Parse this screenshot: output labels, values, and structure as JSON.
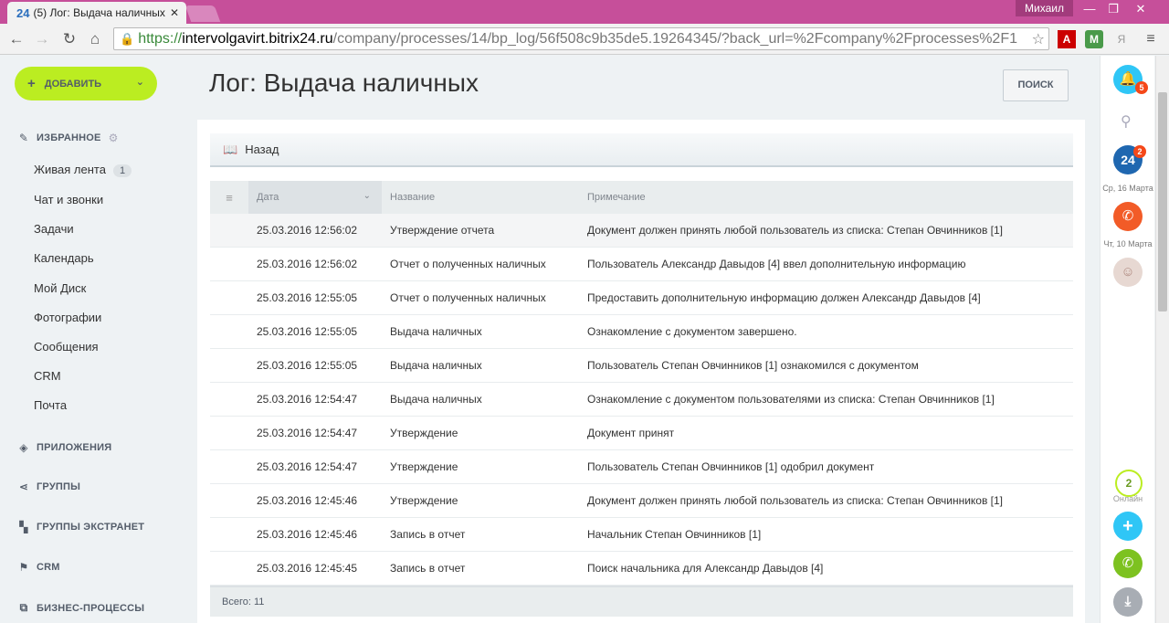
{
  "browser": {
    "tab_favicon": "24",
    "tab_title": "(5) Лог: Выдача наличных",
    "user_name": "Михаил",
    "url_scheme": "https://",
    "url_host": "intervolgavirt.bitrix24.ru",
    "url_path": "/company/processes/14/bp_log/56f508c9b35de5.19264345/?back_url=%2Fcompany%2Fprocesses%2F1",
    "extensions": [
      "pdf-icon",
      "monitor-icon",
      "yandex-icon",
      "menu-icon"
    ],
    "ext_labels": {
      "pdf": "A",
      "monitor": "M",
      "yandex": "Я",
      "menu": "≡"
    }
  },
  "sidebar": {
    "add_label": "ДОБАВИТЬ",
    "favorites_label": "ИЗБРАННОЕ",
    "items": [
      {
        "label": "Живая лента",
        "counter": "1"
      },
      {
        "label": "Чат и звонки"
      },
      {
        "label": "Задачи"
      },
      {
        "label": "Календарь"
      },
      {
        "label": "Мой Диск"
      },
      {
        "label": "Фотографии"
      },
      {
        "label": "Сообщения"
      },
      {
        "label": "CRM"
      },
      {
        "label": "Почта"
      }
    ],
    "sections": [
      {
        "label": "ПРИЛОЖЕНИЯ",
        "icon": "cube-icon"
      },
      {
        "label": "ГРУППЫ",
        "icon": "share-icon"
      },
      {
        "label": "ГРУППЫ ЭКСТРАНЕТ",
        "icon": "grid-icon"
      },
      {
        "label": "CRM",
        "icon": "flag-icon"
      },
      {
        "label": "БИЗНЕС-ПРОЦЕССЫ",
        "icon": "process-icon"
      }
    ]
  },
  "main": {
    "title": "Лог: Выдача наличных",
    "search_label": "ПОИСК",
    "back_label": "Назад",
    "columns": {
      "date": "Дата",
      "name": "Название",
      "note": "Примечание"
    },
    "rows": [
      {
        "date": "25.03.2016 12:56:02",
        "name": "Утверждение отчета",
        "note": "Документ должен принять любой пользователь из списка: Степан Овчинников [1]"
      },
      {
        "date": "25.03.2016 12:56:02",
        "name": "Отчет о полученных наличных",
        "note": "Пользователь Александр Давыдов [4] ввел дополнительную информацию"
      },
      {
        "date": "25.03.2016 12:55:05",
        "name": "Отчет о полученных наличных",
        "note": "Предоставить дополнительную информацию должен Александр Давыдов [4]"
      },
      {
        "date": "25.03.2016 12:55:05",
        "name": "Выдача наличных",
        "note": "Ознакомление с документом завершено."
      },
      {
        "date": "25.03.2016 12:55:05",
        "name": "Выдача наличных",
        "note": "Пользователь Степан Овчинников [1] ознакомился с документом"
      },
      {
        "date": "25.03.2016 12:54:47",
        "name": "Выдача наличных",
        "note": "Ознакомление с документом пользователями из списка: Степан Овчинников [1]"
      },
      {
        "date": "25.03.2016 12:54:47",
        "name": "Утверждение",
        "note": "Документ принят"
      },
      {
        "date": "25.03.2016 12:54:47",
        "name": "Утверждение",
        "note": "Пользователь Степан Овчинников [1] одобрил документ"
      },
      {
        "date": "25.03.2016 12:45:46",
        "name": "Утверждение",
        "note": "Документ должен принять любой пользователь из списка: Степан Овчинников [1]"
      },
      {
        "date": "25.03.2016 12:45:46",
        "name": "Запись в отчет",
        "note": "Начальник Степан Овчинников [1]"
      },
      {
        "date": "25.03.2016 12:45:45",
        "name": "Запись в отчет",
        "note": "Поиск начальника для Александр Давыдов [4]"
      }
    ],
    "total_label": "Всего: 11"
  },
  "rightbar": {
    "notifications_count": "5",
    "chat_count": "2",
    "chat_label": "24",
    "chat_date": "Ср, 16 Марта",
    "call_date": "Чт, 10 Марта",
    "online_count": "2",
    "online_label": "Онлайн"
  },
  "colors": {
    "titlebar": "#c64f9a",
    "add_button": "#bbed21",
    "notify_blue": "#2fc6f6",
    "chat_blue": "#1f67b0",
    "call_orange": "#f25b27",
    "phone_green": "#7dc220"
  }
}
